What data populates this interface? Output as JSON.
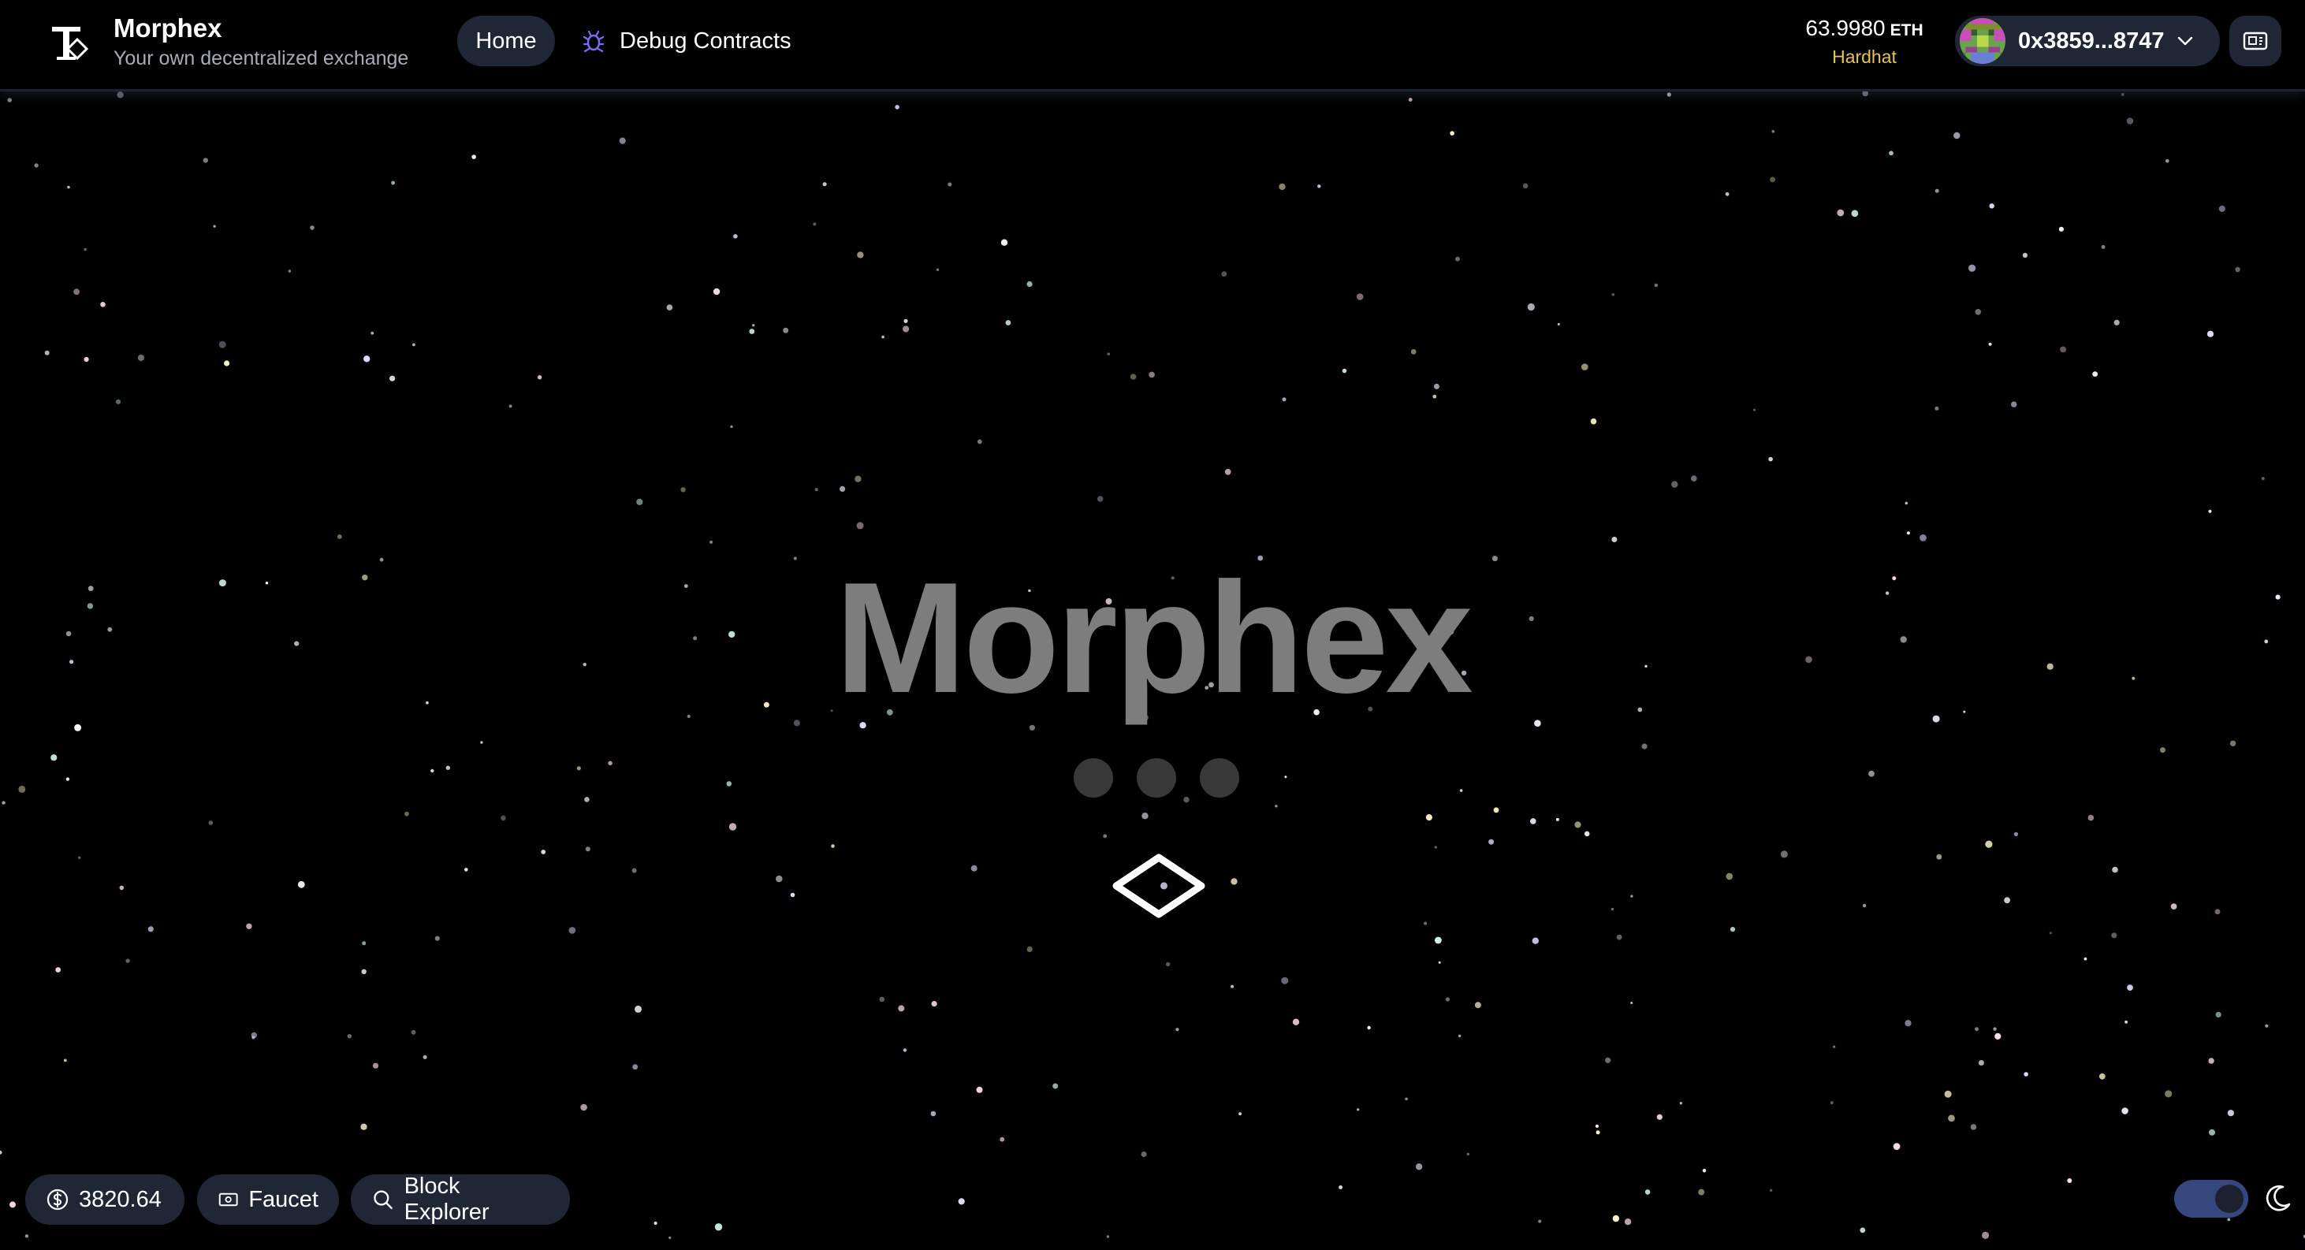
{
  "header": {
    "brand_name": "Morphex",
    "brand_tagline": "Your own decentralized exchange",
    "nav": {
      "home_label": "Home",
      "debug_label": "Debug Contracts"
    },
    "balance": {
      "amount": "63.9980",
      "unit": "ETH",
      "network": "Hardhat"
    },
    "account": {
      "address": "0x3859...8747"
    }
  },
  "hero": {
    "title": "Morphex",
    "loading_dots": 3
  },
  "footer": {
    "price": "3820.64",
    "faucet_label": "Faucet",
    "explorer_label": "Block Explorer",
    "dark_mode_enabled": true
  },
  "colors": {
    "background": "#000000",
    "pill_background": "#1f2636",
    "network_color": "#e6c24f",
    "title_color": "#7d7d7d",
    "toggle_on": "#36477e"
  },
  "icons": {
    "logo": "morphex-logo-icon",
    "debug": "bug-icon",
    "chevron": "chevron-down-icon",
    "qr": "qr-code-icon",
    "price": "dollar-circle-icon",
    "faucet": "banknote-icon",
    "explorer": "search-icon",
    "theme": "moon-icon",
    "hero": "diamond-icon"
  }
}
